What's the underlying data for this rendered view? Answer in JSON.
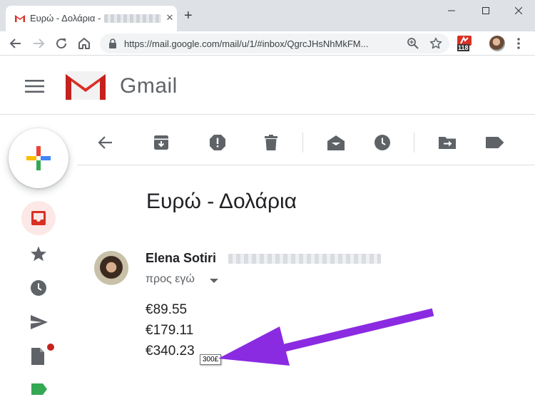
{
  "browser": {
    "tab_title": "Ευρώ - Δολάρια -",
    "tab_close": "✕",
    "new_tab": "+",
    "url": "https://mail.google.com/mail/u/1/#inbox/QgrcJHsNhMkFM...",
    "extension_badge": "118"
  },
  "gmail": {
    "wordmark": "Gmail"
  },
  "rail": {
    "items": [
      "inbox-icon",
      "star-icon",
      "clock-icon",
      "send-icon",
      "draft-icon",
      "label-icon"
    ]
  },
  "message": {
    "subject": "Ευρώ - Δολάρια",
    "sender_name": "Elena Sotiri",
    "recipients": "προς εγώ",
    "amounts": [
      "€89.55",
      "€179.11",
      "€340.23"
    ],
    "tooltip": "300£"
  },
  "colors": {
    "annotation_arrow": "#8a2be2",
    "gmail_red": "#d93025"
  }
}
